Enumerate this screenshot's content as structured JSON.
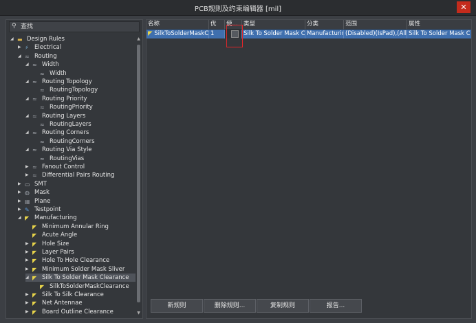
{
  "window": {
    "title": "PCB规则及约束编辑器 [mil]",
    "close_glyph": "✕"
  },
  "search": {
    "placeholder": "查找"
  },
  "tree": [
    {
      "label": "Design Rules",
      "arrow": "◢",
      "icon": "folder-icon"
    },
    {
      "label": "Electrical",
      "arrow": "▶",
      "icon": "electrical-icon"
    },
    {
      "label": "Routing",
      "arrow": "◢",
      "icon": "routing-icon"
    },
    {
      "label": "Width",
      "arrow": "◢",
      "icon": "routing-icon"
    },
    {
      "label": "Width",
      "arrow": "",
      "icon": "routing-icon"
    },
    {
      "label": "Routing Topology",
      "arrow": "◢",
      "icon": "routing-icon"
    },
    {
      "label": "RoutingTopology",
      "arrow": "",
      "icon": "routing-icon"
    },
    {
      "label": "Routing Priority",
      "arrow": "◢",
      "icon": "routing-icon"
    },
    {
      "label": "RoutingPriority",
      "arrow": "",
      "icon": "routing-icon"
    },
    {
      "label": "Routing Layers",
      "arrow": "◢",
      "icon": "routing-icon"
    },
    {
      "label": "RoutingLayers",
      "arrow": "",
      "icon": "routing-icon"
    },
    {
      "label": "Routing Corners",
      "arrow": "◢",
      "icon": "routing-icon"
    },
    {
      "label": "RoutingCorners",
      "arrow": "",
      "icon": "routing-icon"
    },
    {
      "label": "Routing Via Style",
      "arrow": "◢",
      "icon": "routing-icon"
    },
    {
      "label": "RoutingVias",
      "arrow": "",
      "icon": "routing-icon"
    },
    {
      "label": "Fanout Control",
      "arrow": "▶",
      "icon": "routing-icon"
    },
    {
      "label": "Differential Pairs Routing",
      "arrow": "▶",
      "icon": "routing-icon"
    },
    {
      "label": "SMT",
      "arrow": "▶",
      "icon": "smt-icon"
    },
    {
      "label": "Mask",
      "arrow": "▶",
      "icon": "mask-icon"
    },
    {
      "label": "Plane",
      "arrow": "▶",
      "icon": "plane-icon"
    },
    {
      "label": "Testpoint",
      "arrow": "▶",
      "icon": "testpoint-icon"
    },
    {
      "label": "Manufacturing",
      "arrow": "◢",
      "icon": "manufacturing-icon"
    },
    {
      "label": "Minimum Annular Ring",
      "arrow": "",
      "icon": "manufacturing-icon"
    },
    {
      "label": "Acute Angle",
      "arrow": "",
      "icon": "manufacturing-icon"
    },
    {
      "label": "Hole Size",
      "arrow": "▶",
      "icon": "manufacturing-icon"
    },
    {
      "label": "Layer Pairs",
      "arrow": "▶",
      "icon": "manufacturing-icon"
    },
    {
      "label": "Hole To Hole Clearance",
      "arrow": "▶",
      "icon": "manufacturing-icon"
    },
    {
      "label": "Minimum Solder Mask Sliver",
      "arrow": "▶",
      "icon": "manufacturing-icon"
    },
    {
      "label": "Silk To Solder Mask Clearance",
      "arrow": "◢",
      "icon": "manufacturing-icon",
      "selected": true
    },
    {
      "label": "SilkToSolderMaskClearance",
      "arrow": "",
      "icon": "manufacturing-icon"
    },
    {
      "label": "Silk To Silk Clearance",
      "arrow": "▶",
      "icon": "manufacturing-icon"
    },
    {
      "label": "Net Antennae",
      "arrow": "▶",
      "icon": "manufacturing-icon"
    },
    {
      "label": "Board Outline Clearance",
      "arrow": "▶",
      "icon": "manufacturing-icon"
    }
  ],
  "grid": {
    "headers": [
      "名称",
      "优",
      "使...",
      "类型",
      "分类",
      "范围",
      "属性"
    ],
    "rows": [
      {
        "name": "SilkToSolderMaskCl",
        "priority": "1",
        "enabled": "",
        "type": "Silk To Solder Mask Cl",
        "category": "Manufacturir",
        "scope": "(Disabled)(IsPad),(All)",
        "attributes": "Silk To Solder Mask Cl"
      }
    ]
  },
  "buttons": {
    "new_rule": "新规则",
    "delete_rule": "删除规则...",
    "copy_rule": "复制规则",
    "report": "报告..."
  },
  "colors": {
    "selected_row": "#3f6fae",
    "highlight_box": "#e0262a",
    "manufacturing_icon": "#e8d44a"
  }
}
